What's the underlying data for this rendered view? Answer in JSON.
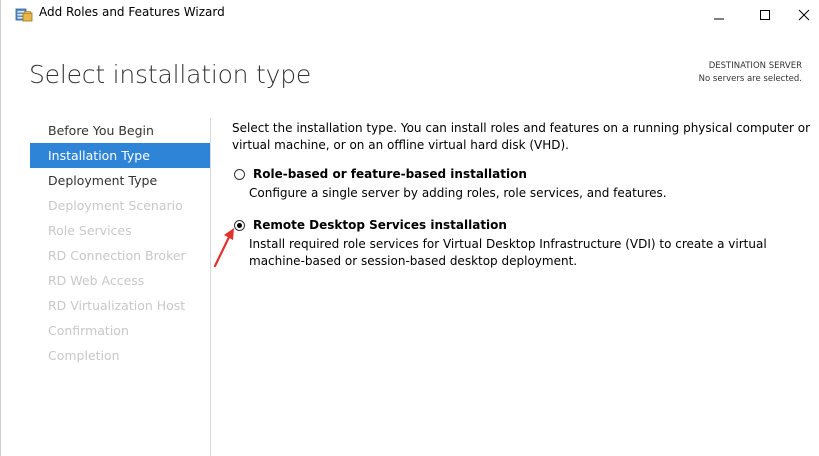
{
  "window": {
    "title": "Add Roles and Features Wizard",
    "icon": "server-manager-icon",
    "controls": [
      "minimize-icon",
      "maximize-icon",
      "close-icon"
    ]
  },
  "header": {
    "title": "Select installation type",
    "destination_label": "DESTINATION SERVER",
    "destination_value": "No servers are selected."
  },
  "nav": {
    "items": [
      {
        "label": "Before You Begin",
        "state": "enabled"
      },
      {
        "label": "Installation Type",
        "state": "active"
      },
      {
        "label": "Deployment Type",
        "state": "enabled"
      },
      {
        "label": "Deployment Scenario",
        "state": "disabled"
      },
      {
        "label": "Role Services",
        "state": "disabled"
      },
      {
        "label": "RD Connection Broker",
        "state": "disabled"
      },
      {
        "label": "RD Web Access",
        "state": "disabled"
      },
      {
        "label": "RD Virtualization Host",
        "state": "disabled"
      },
      {
        "label": "Confirmation",
        "state": "disabled"
      },
      {
        "label": "Completion",
        "state": "disabled"
      }
    ]
  },
  "content": {
    "description": "Select the installation type. You can install roles and features on a running physical computer or virtual machine, or on an offline virtual hard disk (VHD).",
    "options": [
      {
        "title": "Role-based or feature-based installation",
        "description": "Configure a single server by adding roles, role services, and features.",
        "selected": false
      },
      {
        "title": "Remote Desktop Services installation",
        "description": "Install required role services for Virtual Desktop Infrastructure (VDI) to create a virtual machine-based or session-based desktop deployment.",
        "selected": true
      }
    ]
  },
  "colors": {
    "accent": "#2e84d6",
    "annotation_arrow": "#e2312d",
    "disabled_text": "#c8c8c8"
  }
}
